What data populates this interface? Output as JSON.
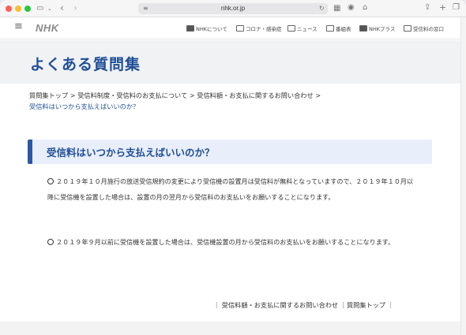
{
  "browser": {
    "url": "nhk.or.jp",
    "colors": {
      "close": "#ff5f57",
      "minimize": "#febc2e",
      "zoom": "#28c840"
    }
  },
  "header": {
    "logo": "NHK",
    "nav": [
      {
        "label": "NHKについて",
        "icon": "monitor-icon"
      },
      {
        "label": "コロナ・感染症",
        "icon": "virus-icon"
      },
      {
        "label": "ニュース",
        "icon": "news-icon"
      },
      {
        "label": "番組表",
        "icon": "calendar-icon"
      },
      {
        "label": "NHKプラス",
        "icon": "plus-icon"
      },
      {
        "label": "受信料の窓口",
        "icon": "fee-icon"
      }
    ]
  },
  "page": {
    "title": "よくある質問集",
    "breadcrumb": {
      "items": [
        "質問集トップ",
        "受信料制度・受信料のお支払について",
        "受信料額・お支払に関するお問い合わせ"
      ],
      "current": "受信料はいつから支払えばいいのか？"
    },
    "question": "受信料はいつから支払えばいいのか？",
    "answers": [
      "２０１９年１０月施行の放送受信規約の変更により受信機の設置月は受信料が無料となっていますので、２０１９年１０月以降に受信機を設置した場合は、設置の月の翌月から受信料のお支払いをお願いすることになります。",
      "２０１９年９月以前に受信機を設置した場合は、受信機設置の月から受信料のお支払いをお願いすることになります。"
    ],
    "footer_links": [
      "受信料額・お支払に関するお問い合わせ",
      "質問集トップ"
    ]
  }
}
